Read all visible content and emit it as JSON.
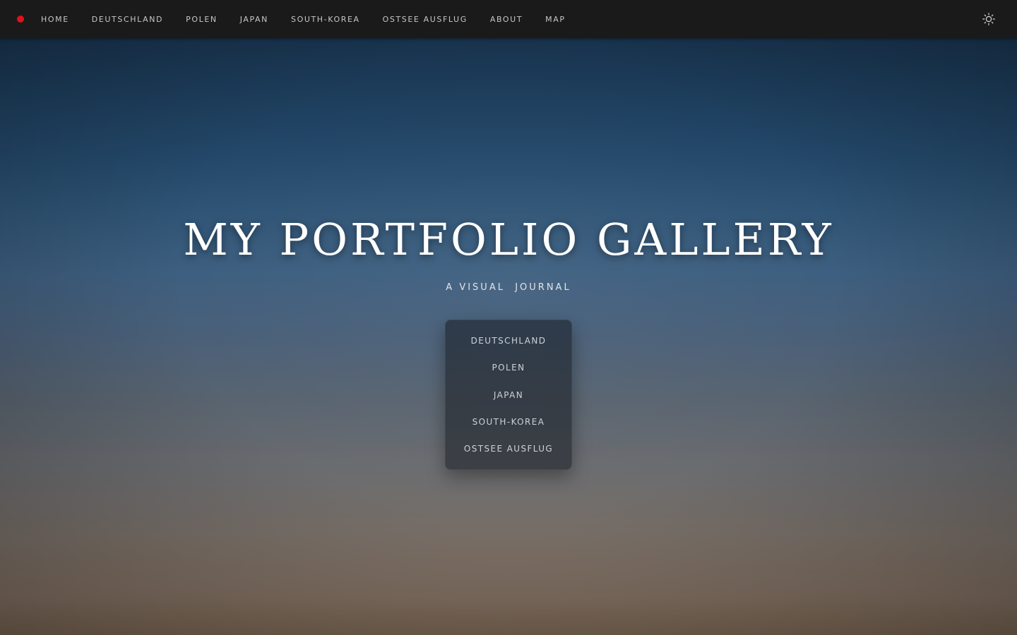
{
  "header": {
    "brand_color": "#e0111a",
    "nav": [
      {
        "label": "HOME"
      },
      {
        "label": "DEUTSCHLAND"
      },
      {
        "label": "POLEN"
      },
      {
        "label": "JAPAN"
      },
      {
        "label": "SOUTH-KOREA"
      },
      {
        "label": "OSTSEE AUSFLUG"
      },
      {
        "label": "ABOUT"
      },
      {
        "label": "MAP"
      }
    ],
    "theme_toggle_icon": "sun-icon"
  },
  "hero": {
    "title": "MY PORTFOLIO GALLERY",
    "subtitle": "A VISUAL  JOURNAL"
  },
  "menu": {
    "items": [
      {
        "label": "DEUTSCHLAND"
      },
      {
        "label": "POLEN"
      },
      {
        "label": "JAPAN"
      },
      {
        "label": "SOUTH-KOREA"
      },
      {
        "label": "OSTSEE AUSFLUG"
      }
    ]
  }
}
